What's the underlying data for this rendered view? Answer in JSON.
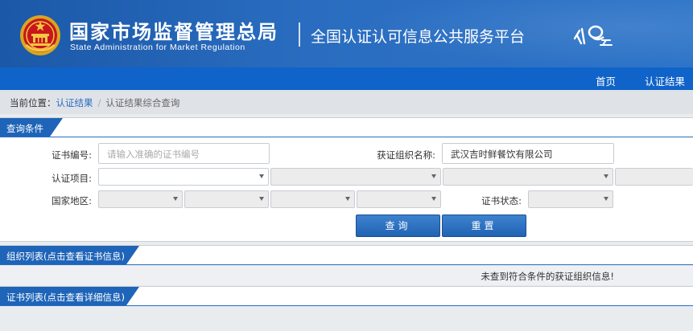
{
  "header": {
    "title_cn": "国家市场监督管理总局",
    "title_en": "State Administration  for  Market Regulation",
    "platform": "全国认证认可信息公共服务平台",
    "emblem_icon": "national-emblem-icon",
    "logo_icon": "cert-cloud-logo-icon"
  },
  "nav": {
    "items": [
      "首页",
      "认证结果"
    ]
  },
  "breadcrumb": {
    "prefix": "当前位置：",
    "link": "认证结果",
    "separator": "/",
    "current": "认证结果综合查询"
  },
  "query": {
    "tab_label": "查询条件",
    "cert_no_label": "证书编号:",
    "cert_no_placeholder": "请输入准确的证书编号",
    "org_name_label": "获证组织名称:",
    "org_name_value": "武汉吉时鲜餐饮有限公司",
    "project_label": "认证项目:",
    "region_label": "国家地区:",
    "status_label": "证书状态:",
    "search_button": "查询",
    "reset_button": "重置"
  },
  "org_list": {
    "tab_label": "组织列表(点击查看证书信息)",
    "empty_message": "未查到符合条件的获证组织信息!"
  },
  "cert_list": {
    "tab_label": "证书列表(点击查看详细信息)"
  },
  "colors": {
    "header_blue": "#1b58a8",
    "nav_blue": "#0f63c9",
    "tab_blue": "#1e64b8",
    "button_blue": "#2a6dc0"
  }
}
